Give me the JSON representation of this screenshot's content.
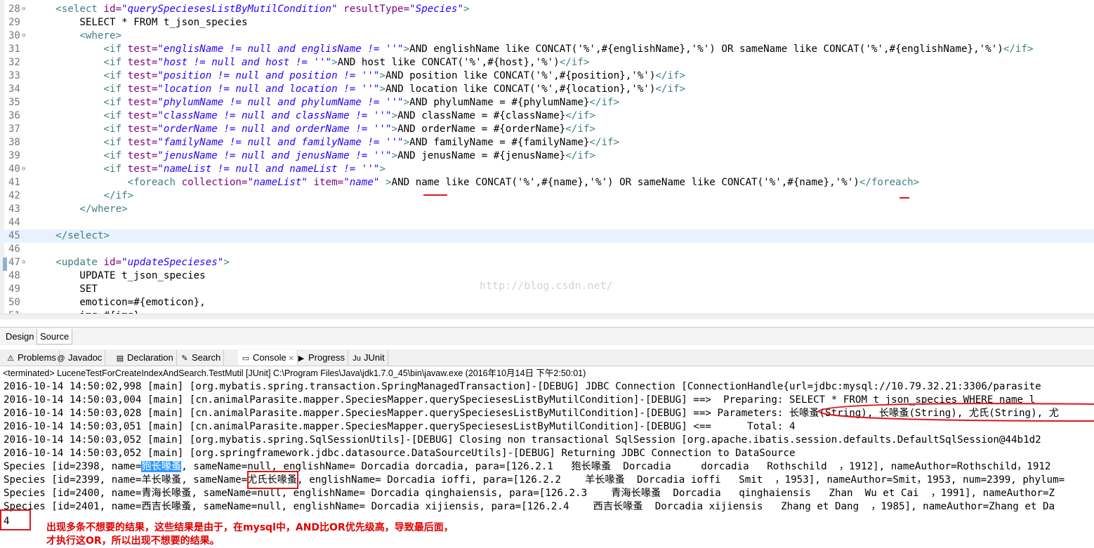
{
  "editor": {
    "lines": [
      {
        "n": "28",
        "fold": true,
        "seg": [
          [
            "t",
            "    <select "
          ],
          [
            "a",
            "id="
          ],
          [
            "v",
            "\"querySpeciesesListByMutilCondition\""
          ],
          [
            "a",
            " resultType="
          ],
          [
            "v",
            "\"Species\""
          ],
          [
            "t",
            ">"
          ]
        ]
      },
      {
        "n": "29",
        "seg": [
          [
            "x",
            "        SELECT * FROM t_json_species"
          ]
        ]
      },
      {
        "n": "30",
        "fold": true,
        "seg": [
          [
            "t",
            "        <where>"
          ]
        ]
      },
      {
        "n": "31",
        "seg": [
          [
            "t",
            "            <if "
          ],
          [
            "a",
            "test="
          ],
          [
            "v",
            "\"englisName != null and englisName != ''\""
          ],
          [
            "t",
            ">"
          ],
          [
            "x",
            "AND englishName like CONCAT('%',#{englishName},'%') OR sameName like CONCAT('%',#{englishName},'%')"
          ],
          [
            "t",
            "</if>"
          ]
        ]
      },
      {
        "n": "32",
        "seg": [
          [
            "t",
            "            <if "
          ],
          [
            "a",
            "test="
          ],
          [
            "v",
            "\"host != null and host != ''\""
          ],
          [
            "t",
            ">"
          ],
          [
            "x",
            "AND host like CONCAT('%',#{host},'%')"
          ],
          [
            "t",
            "</if>"
          ]
        ]
      },
      {
        "n": "33",
        "seg": [
          [
            "t",
            "            <if "
          ],
          [
            "a",
            "test="
          ],
          [
            "v",
            "\"position != null and position != ''\""
          ],
          [
            "t",
            ">"
          ],
          [
            "x",
            "AND position like CONCAT('%',#{position},'%')"
          ],
          [
            "t",
            "</if>"
          ]
        ]
      },
      {
        "n": "34",
        "seg": [
          [
            "t",
            "            <if "
          ],
          [
            "a",
            "test="
          ],
          [
            "v",
            "\"location != null and location != ''\""
          ],
          [
            "t",
            ">"
          ],
          [
            "x",
            "AND location like CONCAT('%',#{location},'%')"
          ],
          [
            "t",
            "</if>"
          ]
        ]
      },
      {
        "n": "35",
        "seg": [
          [
            "t",
            "            <if "
          ],
          [
            "a",
            "test="
          ],
          [
            "v",
            "\"phylumName != null and phylumName != ''\""
          ],
          [
            "t",
            ">"
          ],
          [
            "x",
            "AND phylumName = #{phylumName}"
          ],
          [
            "t",
            "</if>"
          ]
        ]
      },
      {
        "n": "36",
        "seg": [
          [
            "t",
            "            <if "
          ],
          [
            "a",
            "test="
          ],
          [
            "v",
            "\"className != null and className != ''\""
          ],
          [
            "t",
            ">"
          ],
          [
            "x",
            "AND className = #{className}"
          ],
          [
            "t",
            "</if>"
          ]
        ]
      },
      {
        "n": "37",
        "seg": [
          [
            "t",
            "            <if "
          ],
          [
            "a",
            "test="
          ],
          [
            "v",
            "\"orderName != null and orderName != ''\""
          ],
          [
            "t",
            ">"
          ],
          [
            "x",
            "AND orderName = #{orderName}"
          ],
          [
            "t",
            "</if>"
          ]
        ]
      },
      {
        "n": "38",
        "seg": [
          [
            "t",
            "            <if "
          ],
          [
            "a",
            "test="
          ],
          [
            "v",
            "\"familyName != null and familyName != ''\""
          ],
          [
            "t",
            ">"
          ],
          [
            "x",
            "AND familyName = #{familyName}"
          ],
          [
            "t",
            "</if>"
          ]
        ]
      },
      {
        "n": "39",
        "seg": [
          [
            "t",
            "            <if "
          ],
          [
            "a",
            "test="
          ],
          [
            "v",
            "\"jenusName != null and jenusName != ''\""
          ],
          [
            "t",
            ">"
          ],
          [
            "x",
            "AND jenusName = #{jenusName}"
          ],
          [
            "t",
            "</if>"
          ]
        ]
      },
      {
        "n": "40",
        "fold": true,
        "seg": [
          [
            "t",
            "            <if "
          ],
          [
            "a",
            "test="
          ],
          [
            "v",
            "\"nameList != null and nameList != ''\""
          ],
          [
            "t",
            ">"
          ]
        ]
      },
      {
        "n": "41",
        "seg": [
          [
            "t",
            "                <foreach "
          ],
          [
            "a",
            "collection="
          ],
          [
            "v",
            "\"nameList\""
          ],
          [
            "a",
            " item="
          ],
          [
            "v",
            "\"name\""
          ],
          [
            "t",
            " >"
          ],
          [
            "x",
            "AND name like CONCAT('%',#{name},'%') OR sameName like CONCAT('%',#{name},'%')"
          ],
          [
            "t",
            "</foreach>"
          ]
        ]
      },
      {
        "n": "42",
        "seg": [
          [
            "t",
            "            </if>"
          ]
        ]
      },
      {
        "n": "43",
        "seg": [
          [
            "t",
            "        </where>"
          ]
        ]
      },
      {
        "n": "44",
        "seg": []
      },
      {
        "n": "45",
        "current": true,
        "seg": [
          [
            "t",
            "    </select>"
          ]
        ]
      },
      {
        "n": "46",
        "seg": []
      },
      {
        "n": "47",
        "fold": true,
        "seg": [
          [
            "t",
            "    <update "
          ],
          [
            "a",
            "id="
          ],
          [
            "v",
            "\"updateSpecieses\""
          ],
          [
            "t",
            ">"
          ]
        ]
      },
      {
        "n": "48",
        "seg": [
          [
            "x",
            "        UPDATE t_json_species"
          ]
        ]
      },
      {
        "n": "49",
        "seg": [
          [
            "x",
            "        SET"
          ]
        ]
      },
      {
        "n": "50",
        "seg": [
          [
            "x",
            "        emoticon=#{emoticon},"
          ]
        ]
      },
      {
        "n": "51",
        "seg": [
          [
            "x",
            "        img=#{img},"
          ]
        ]
      }
    ],
    "watermark": "http://blog.csdn.net/"
  },
  "source_tabs": [
    "Design",
    "Source"
  ],
  "view_tabs": [
    {
      "label": "Problems",
      "icon": "problems-icon"
    },
    {
      "label": "Javadoc",
      "icon": "javadoc-icon"
    },
    {
      "label": "Declaration",
      "icon": "declaration-icon"
    },
    {
      "label": "Search",
      "icon": "search-icon"
    },
    {
      "label": "Console",
      "icon": "console-icon",
      "active": true
    },
    {
      "label": "Progress",
      "icon": "progress-icon"
    },
    {
      "label": "JUnit",
      "icon": "junit-icon"
    }
  ],
  "console": {
    "status": "<terminated> LuceneTestForCreateIndexAndSearch.TestMutil [JUnit] C:\\Program Files\\Java\\jdk1.7.0_45\\bin\\javaw.exe (2016年10月14日 下午2:50:01)",
    "lines": [
      "2016-10-14 14:50:02,998 [main] [org.mybatis.spring.transaction.SpringManagedTransaction]-[DEBUG] JDBC Connection [ConnectionHandle{url=jdbc:mysql://10.79.32.21:3306/parasite",
      "2016-10-14 14:50:03,004 [main] [cn.animalParasite.mapper.SpeciesMapper.querySpeciesesListByMutilCondition]-[DEBUG] ==>  Preparing: SELECT * FROM t_json_species WHERE name l",
      "2016-10-14 14:50:03,028 [main] [cn.animalParasite.mapper.SpeciesMapper.querySpeciesesListByMutilCondition]-[DEBUG] ==> Parameters: 长喙蚤(String), 长喙蚤(String), 尤氏(String), 尤",
      "2016-10-14 14:50:03,051 [main] [cn.animalParasite.mapper.SpeciesMapper.querySpeciesesListByMutilCondition]-[DEBUG] <==      Total: 4",
      "2016-10-14 14:50:03,052 [main] [org.mybatis.spring.SqlSessionUtils]-[DEBUG] Closing non transactional SqlSession [org.apache.ibatis.session.defaults.DefaultSqlSession@44b1d2",
      "2016-10-14 14:50:03,052 [main] [org.springframework.jdbc.datasource.DataSourceUtils]-[DEBUG] Returning JDBC Connection to DataSource"
    ],
    "species": [
      {
        "pre": "Species [id=2398, name=",
        "name": "狍长喙蚤",
        "post": ", sameName=null, englishName= Dorcadia dorcadia, para=[126.2.1   狍长喙蚤  Dorcadia     dorcadia   Rothschild  ，1912], nameAuthor=Rothschild，1912"
      },
      {
        "pre": "Species [id=2399, name=羊长喙蚤, sameName=",
        "name": "尤氏长喙蚤",
        "post": ", englishName= Dorcadia ioffi, para=[126.2.2    羊长喙蚤  Dorcadia ioffi   Smit  ，1953], nameAuthor=Smit，1953, num=2399, phylum="
      },
      {
        "pre": "Species [id=2400, name=青海长喙蚤, sameName=null, englishName= Dorcadia qinghaiensis, para=[126.2.3    青海长喙蚤  Dorcadia   qinghaiensis   Zhan  Wu et Cai  ，1991], nameAuthor=Z",
        "name": "",
        "post": ""
      },
      {
        "pre": "Species [id=2401, name=西吉长喙蚤, sameName=null, englishName= Dorcadia xijiensis, para=[126.2.4    西吉长喙蚤  Dorcadia xijiensis   Zhang et Dang  ，1985], nameAuthor=Zhang et Da",
        "name": "",
        "post": ""
      }
    ],
    "count": "4"
  },
  "annotation": {
    "line1": "出现多条不想要的结果，这些结果是由于，在mysql中，AND比OR优先级高，导致最后面，",
    "line2": "才执行这OR，所以出现不想要的结果。",
    "color": "#e0141e"
  }
}
